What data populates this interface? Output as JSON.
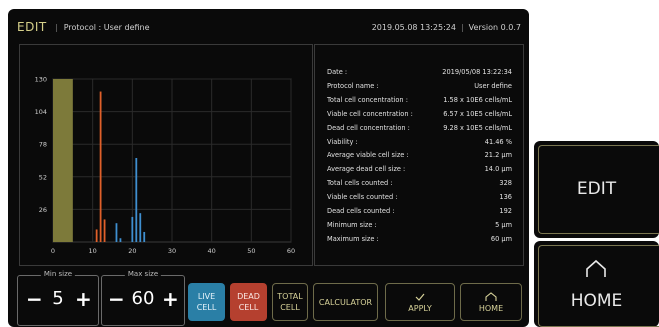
{
  "header": {
    "mode": "EDIT",
    "protocol": "Protocol : User define",
    "datetime": "2019.05.08 13:25:24",
    "version": "Version 0.0.7"
  },
  "chart_data": {
    "type": "bar",
    "xlim": [
      0,
      60
    ],
    "ylim": [
      0,
      130
    ],
    "x_ticks": [
      "0",
      "10",
      "20",
      "30",
      "40",
      "50",
      "60"
    ],
    "y_ticks": [
      "26",
      "52",
      "78",
      "104",
      "130"
    ],
    "grid": true,
    "colors": {
      "total": "#7d7a3a",
      "dead": "#e0602a",
      "live": "#3f8fd0"
    },
    "series": [
      {
        "kind": "total",
        "x": [
          0,
          5
        ],
        "values": [
          130,
          130
        ]
      },
      {
        "kind": "dead",
        "x": [
          11,
          12,
          13
        ],
        "values": [
          10,
          120,
          18
        ]
      },
      {
        "kind": "live",
        "x": [
          16,
          17,
          20,
          21,
          22,
          23
        ],
        "values": [
          15,
          3,
          20,
          67,
          23,
          8
        ]
      }
    ]
  },
  "info": [
    {
      "label": "Date :",
      "value": "2019/05/08 13:22:34"
    },
    {
      "label": "Protocol name :",
      "value": "User define"
    },
    {
      "label": "Total cell concentration :",
      "value": "1.58 x 10E6 cells/mL"
    },
    {
      "label": "Viable cell concentration :",
      "value": "6.57 x 10E5 cells/mL"
    },
    {
      "label": "Dead cell concentration :",
      "value": "9.28 x 10E5 cells/mL"
    },
    {
      "label": "Viability :",
      "value": "41.46 %"
    },
    {
      "label": "Average viable cell size :",
      "value": "21.2 µm"
    },
    {
      "label": "Average dead cell size :",
      "value": "14.0 µm"
    },
    {
      "label": "Total cells counted :",
      "value": "328"
    },
    {
      "label": "Viable cells counted :",
      "value": "136"
    },
    {
      "label": "Dead cells counted :",
      "value": "192"
    },
    {
      "label": "Minimum size :",
      "value": "5 µm"
    },
    {
      "label": "Maximum size :",
      "value": "60 µm"
    }
  ],
  "min_size": {
    "label": "Min size",
    "value": "5",
    "minus": "−",
    "plus": "+"
  },
  "max_size": {
    "label": "Max size",
    "value": "60",
    "minus": "−",
    "plus": "+"
  },
  "toolbar": {
    "live_line1": "LIVE",
    "live_line2": "CELL",
    "dead_line1": "DEAD",
    "dead_line2": "CELL",
    "total_line1": "TOTAL",
    "total_line2": "CELL",
    "calculator": "CALCULATOR",
    "apply": "APPLY",
    "home": "HOME"
  },
  "side": {
    "edit": "EDIT",
    "home": "HOME"
  }
}
